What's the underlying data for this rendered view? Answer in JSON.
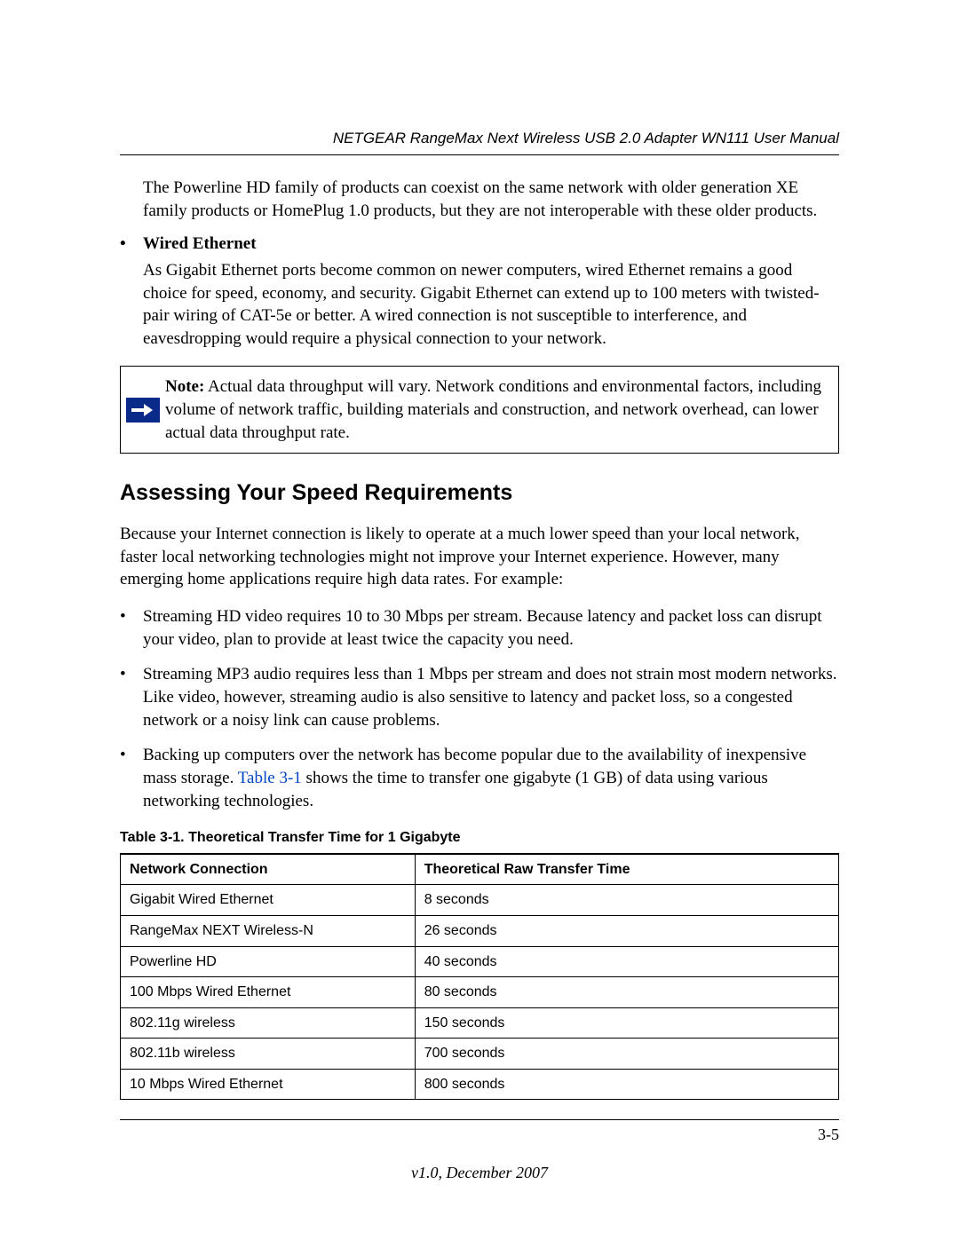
{
  "header": {
    "running_title": "NETGEAR RangeMax Next Wireless USB 2.0 Adapter WN111 User Manual"
  },
  "intro_para": "The Powerline HD family of products can coexist on the same network with older generation XE family products or HomePlug 1.0 products, but they are not interoperable with these older products.",
  "wired": {
    "heading": "Wired Ethernet",
    "text": "As Gigabit Ethernet ports become common on newer computers, wired Ethernet remains a good choice for speed, economy, and security. Gigabit Ethernet can extend up to 100 meters with twisted-pair wiring of CAT-5e or better. A wired connection is not susceptible to interference, and eavesdropping would require a physical connection to your network."
  },
  "note": {
    "label": "Note:",
    "text": " Actual data throughput will vary. Network conditions and environmental factors, including volume of network traffic, building materials and construction, and network overhead, can lower actual data throughput rate."
  },
  "section": {
    "heading": "Assessing Your Speed Requirements",
    "para": "Because your Internet connection is likely to operate at a much lower speed than your local network, faster local networking technologies might not improve your Internet experience. However, many emerging home applications require high data rates. For example:",
    "bullets": [
      "Streaming HD video requires 10 to 30 Mbps per stream. Because latency and packet loss can disrupt your video, plan to provide at least twice the capacity you need.",
      "Streaming MP3 audio requires less than 1 Mbps per stream and does not strain most modern networks. Like video, however, streaming audio is also sensitive to latency and packet loss, so a congested network or a noisy link can cause problems."
    ],
    "bullet3_pre": "Backing up computers over the network has become popular due to the availability of inexpensive mass storage. ",
    "bullet3_link": "Table 3-1",
    "bullet3_post": " shows the time to transfer one gigabyte (1 GB) of data using various networking technologies."
  },
  "table": {
    "caption": "Table 3-1.  Theoretical Transfer Time for 1 Gigabyte",
    "headers": [
      "Network Connection",
      "Theoretical Raw Transfer Time"
    ],
    "rows": [
      [
        "Gigabit Wired Ethernet",
        "8 seconds"
      ],
      [
        "RangeMax NEXT Wireless-N",
        "26 seconds"
      ],
      [
        "Powerline HD",
        "40 seconds"
      ],
      [
        "100 Mbps Wired Ethernet",
        "80 seconds"
      ],
      [
        "802.11g wireless",
        "150 seconds"
      ],
      [
        "802.11b wireless",
        "700 seconds"
      ],
      [
        "10 Mbps Wired Ethernet",
        "800 seconds"
      ]
    ]
  },
  "footer": {
    "page_num": "3-5",
    "version": "v1.0, December 2007"
  },
  "chart_data": {
    "type": "table",
    "title": "Theoretical Transfer Time for 1 Gigabyte",
    "columns": [
      "Network Connection",
      "Theoretical Raw Transfer Time"
    ],
    "rows": [
      {
        "connection": "Gigabit Wired Ethernet",
        "time_seconds": 8
      },
      {
        "connection": "RangeMax NEXT Wireless-N",
        "time_seconds": 26
      },
      {
        "connection": "Powerline HD",
        "time_seconds": 40
      },
      {
        "connection": "100 Mbps Wired Ethernet",
        "time_seconds": 80
      },
      {
        "connection": "802.11g wireless",
        "time_seconds": 150
      },
      {
        "connection": "802.11b wireless",
        "time_seconds": 700
      },
      {
        "connection": "10 Mbps Wired Ethernet",
        "time_seconds": 800
      }
    ]
  }
}
